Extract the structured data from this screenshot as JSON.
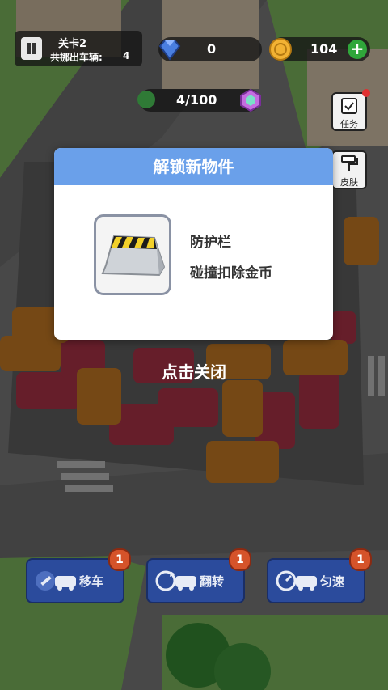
{
  "hud": {
    "level_label": "关卡2",
    "cars_label": "共挪出车辆:",
    "cars_count": "4",
    "gems": "0",
    "coins": "104",
    "progress": "4/100"
  },
  "side_buttons": {
    "task_label": "任务",
    "skin_label": "皮肤"
  },
  "modal": {
    "title": "解锁新物件",
    "item_name": "防护栏",
    "item_desc": "碰撞扣除金币"
  },
  "close_hint": "点击关闭",
  "tools": [
    {
      "label": "移车",
      "count": "1"
    },
    {
      "label": "翻转",
      "count": "1"
    },
    {
      "label": "匀速",
      "count": "1"
    }
  ],
  "colors": {
    "modal_header": "#6aa0ea",
    "tool_button": "#2b4b9c",
    "badge": "#d5532a",
    "car_red": "#c43a52",
    "car_orange": "#e08a2a"
  }
}
